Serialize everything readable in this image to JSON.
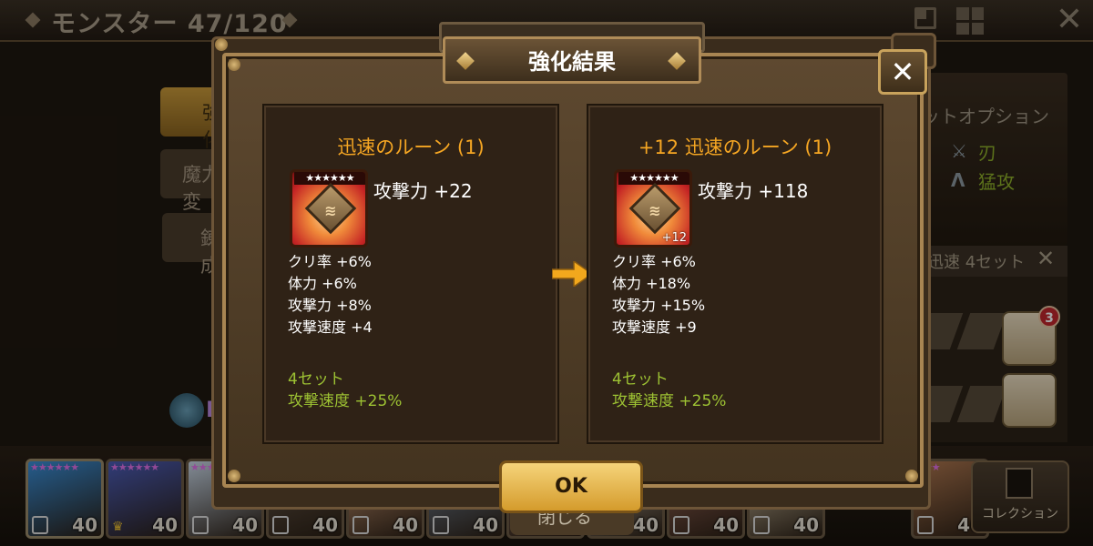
{
  "background": {
    "title": "モンスター 47/120",
    "close_symbol": "✕",
    "tabs": [
      {
        "label": "強化"
      },
      {
        "label": "魔力変"
      },
      {
        "label": "錬成"
      }
    ],
    "l_label": "L",
    "set_options_title": "ットオプション",
    "set_options": [
      {
        "icon": "blade-icon",
        "label": "刃"
      },
      {
        "icon": "fatal-icon",
        "label": "猛攻"
      }
    ],
    "set_filter": "迅速 4セット",
    "set_filter_close": "✕",
    "badge_count": "3",
    "monsters": [
      {
        "stars": "★★★★★★",
        "level": "40",
        "color": "#3a8fd8",
        "crown": false,
        "star_color": "#e070e8"
      },
      {
        "stars": "★★★★★★",
        "level": "40",
        "color": "#4c5db8",
        "crown": true,
        "star_color": "#e070e8"
      },
      {
        "stars": "★★★",
        "level": "40",
        "color": "#c9d7e6",
        "crown": false,
        "star_color": "#e070e8"
      },
      {
        "stars": "",
        "level": "40",
        "color": "#6a5a4a",
        "crown": false,
        "star_color": "#e070e8"
      },
      {
        "stars": "",
        "level": "40",
        "color": "#d6a07a",
        "crown": false,
        "star_color": "#e070e8"
      },
      {
        "stars": "",
        "level": "40",
        "color": "#7a8ca0",
        "crown": false,
        "star_color": "#e070e8"
      },
      {
        "stars": "",
        "level": "40",
        "color": "#8a6a5a",
        "crown": false,
        "star_color": "#e070e8"
      },
      {
        "stars": "",
        "level": "40",
        "color": "#c8bca8",
        "crown": false,
        "star_color": "#e070e8"
      },
      {
        "stars": "",
        "level": "40",
        "color": "#a06a5a",
        "crown": false,
        "star_color": "#e070e8"
      },
      {
        "stars": "",
        "level": "40",
        "color": "#d8c8a8",
        "crown": false,
        "star_color": "#e070e8"
      },
      {
        "stars": "★★★",
        "level": "40",
        "color": "#b07850",
        "crown": false,
        "star_color": "#e070e8"
      }
    ],
    "collection_label": "コレクション",
    "under_ok_text": "閉じる"
  },
  "dialog": {
    "title": "強化結果",
    "close_symbol": "✕",
    "ok_label": "OK",
    "before": {
      "name": "迅速のルーン (1)",
      "stars": "★★★★★★",
      "plus": "",
      "main_stat": "攻撃力 +22",
      "sub_stats": [
        "クリ率 +6%",
        "体力 +6%",
        "攻撃力 +8%",
        "攻撃速度 +4"
      ],
      "set_name": "4セット",
      "set_bonus": "攻撃速度 +25%"
    },
    "after": {
      "name": "+12 迅速のルーン (1)",
      "stars": "★★★★★★",
      "plus": "+12",
      "main_stat": "攻撃力 +118",
      "sub_stats": [
        "クリ率 +6%",
        "体力 +18%",
        "攻撃力 +15%",
        "攻撃速度 +9"
      ],
      "set_name": "4セット",
      "set_bonus": "攻撃速度 +25%"
    },
    "arrow_color": "#f2a81d",
    "title_color": "#ffffff",
    "rune_name_color": "#f5a623",
    "set_color": "#9dc233"
  }
}
